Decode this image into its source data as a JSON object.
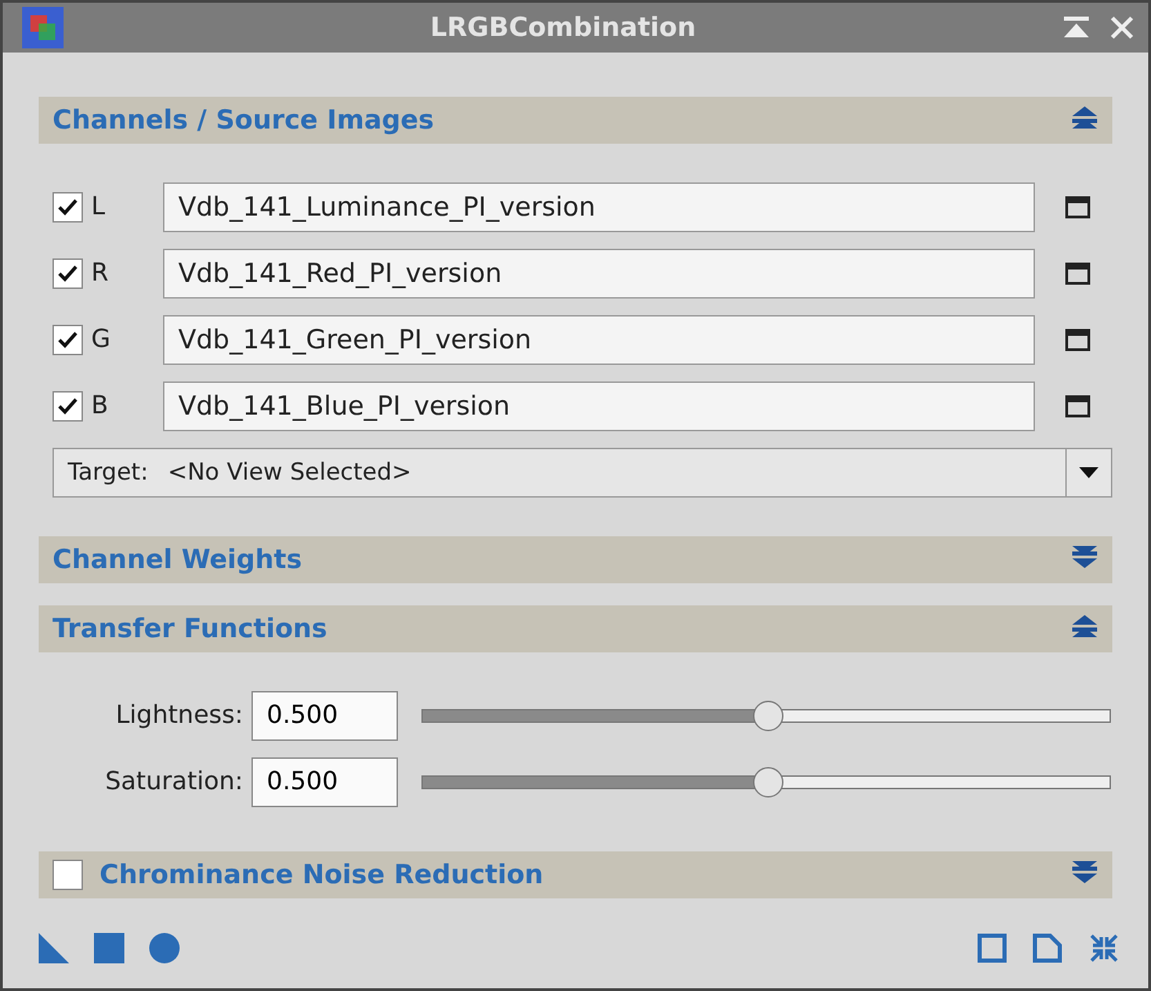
{
  "window": {
    "title": "LRGBCombination"
  },
  "sections": [
    {
      "kind": "channels",
      "title": "Channels / Source Images",
      "expanded": true,
      "channels": [
        {
          "letter": "L",
          "checked": true,
          "view": "Vdb_141_Luminance_PI_version"
        },
        {
          "letter": "R",
          "checked": true,
          "view": "Vdb_141_Red_PI_version"
        },
        {
          "letter": "G",
          "checked": true,
          "view": "Vdb_141_Green_PI_version"
        },
        {
          "letter": "B",
          "checked": true,
          "view": "Vdb_141_Blue_PI_version"
        }
      ],
      "target": {
        "label": "Target:",
        "value": "<No View Selected>"
      }
    },
    {
      "kind": "plain",
      "title": "Channel Weights",
      "expanded": false
    },
    {
      "kind": "transfer",
      "title": "Transfer Functions",
      "expanded": true,
      "sliders": [
        {
          "label": "Lightness:",
          "value": "0.500",
          "level": 0.5
        },
        {
          "label": "Saturation:",
          "value": "0.500",
          "level": 0.5
        }
      ]
    },
    {
      "kind": "checkable",
      "title": "Chrominance Noise Reduction",
      "checked": false,
      "expanded": false
    }
  ]
}
